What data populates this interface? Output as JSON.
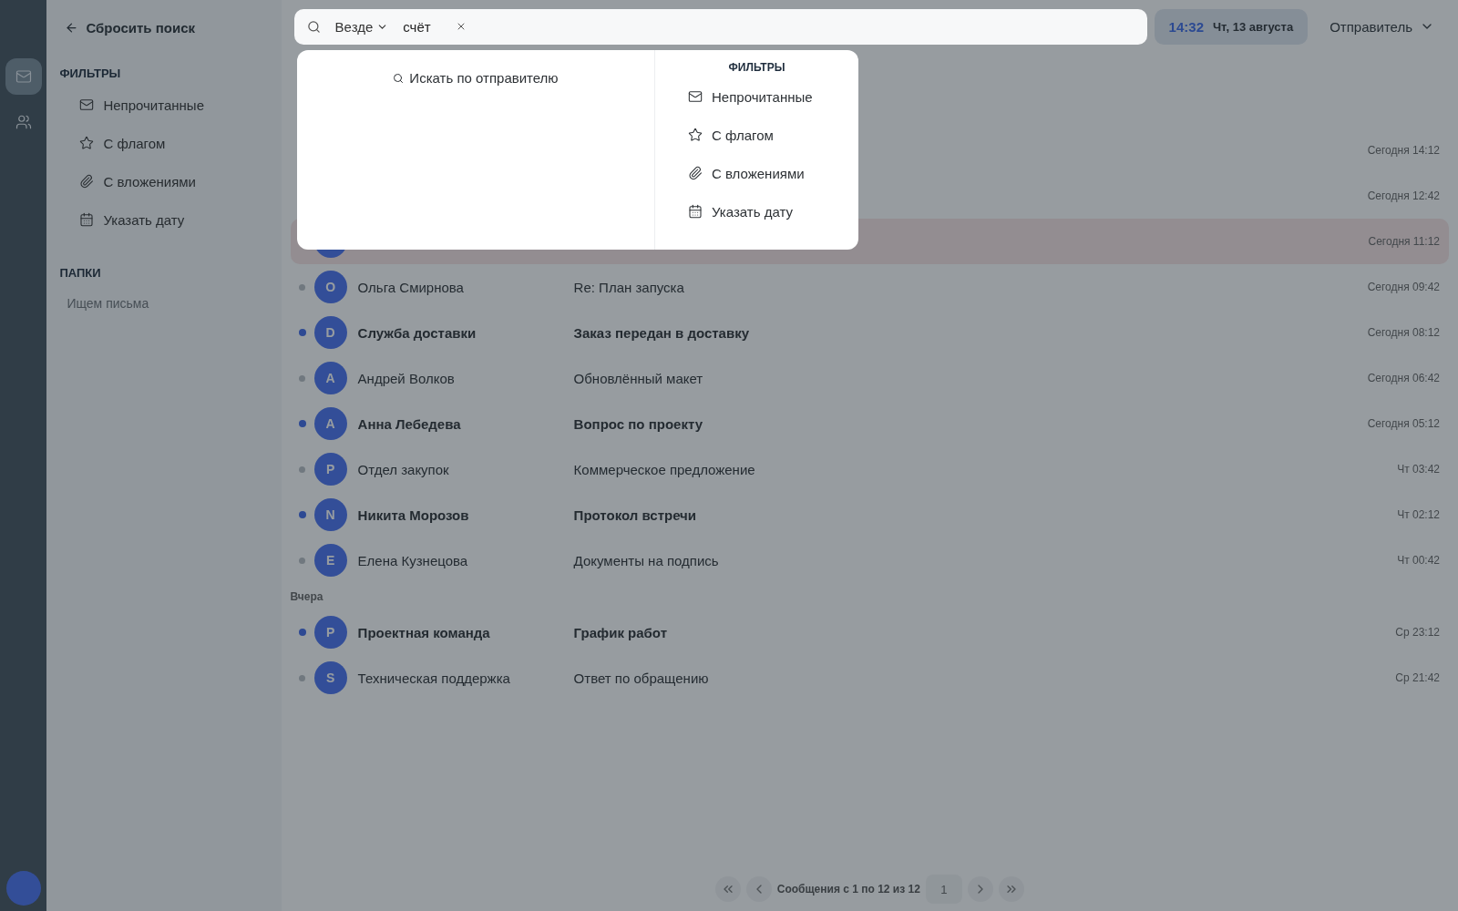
{
  "rail": {
    "items": [
      {
        "kind": "mail",
        "selected": true
      },
      {
        "kind": "users",
        "selected": false
      }
    ]
  },
  "sidebar": {
    "reset": "Сбросить поиск",
    "filters_title": "ФИЛЬТРЫ",
    "filters": [
      {
        "kind": "mail",
        "label": "Непрочитанные"
      },
      {
        "kind": "star",
        "label": "С флагом"
      },
      {
        "kind": "clip",
        "label": "С вложениями"
      },
      {
        "kind": "calendar",
        "label": "Указать дату"
      }
    ],
    "folders_title": "ПАПКИ",
    "folders_status": "Ищем письма"
  },
  "search": {
    "scope": "Везде",
    "query": "счёт"
  },
  "clock": {
    "time": "14:32",
    "date": "Чт, 13 августа"
  },
  "sender_filter": "Отправитель",
  "popup": {
    "search_by_sender": "Искать по отправителю",
    "filters_title": "ФИЛЬТРЫ",
    "filters": [
      {
        "kind": "mail",
        "label": "Непрочитанные"
      },
      {
        "kind": "star",
        "label": "С флагом"
      },
      {
        "kind": "clip",
        "label": "С вложениями"
      },
      {
        "kind": "calendar",
        "label": "Указать дату"
      }
    ]
  },
  "list": {
    "groups": [
      {
        "rows": [
          {
            "date": "Сегодня 14:12",
            "selected": false
          },
          {
            "date": "Сегодня 12:42",
            "selected": false
          },
          {
            "avatar": true,
            "date": "Сегодня 11:12",
            "selected": true
          },
          {
            "unread": false,
            "avatar": "O",
            "sender": "Ольга Смирнова",
            "subject": "Re: План запуска",
            "date": "Сегодня 09:42",
            "selected": false
          },
          {
            "unread": true,
            "avatar": "D",
            "sender": "Служба доставки",
            "subject": "Заказ передан в доставку",
            "date": "Сегодня 08:12",
            "selected": false
          },
          {
            "unread": false,
            "avatar": "A",
            "sender": "Андрей Волков",
            "subject": "Обновлённый макет",
            "date": "Сегодня 06:42",
            "selected": false
          },
          {
            "unread": true,
            "avatar": "A",
            "sender": "Анна Лебедева",
            "subject": "Вопрос по проекту",
            "date": "Сегодня 05:12",
            "selected": false
          },
          {
            "unread": false,
            "avatar": "P",
            "sender": "Отдел закупок",
            "subject": "Коммерческое предложение",
            "date": "Чт 03:42",
            "selected": false
          },
          {
            "unread": true,
            "avatar": "N",
            "sender": "Никита Морозов",
            "subject": "Протокол встречи",
            "date": "Чт 02:12",
            "selected": false
          },
          {
            "unread": false,
            "avatar": "E",
            "sender": "Елена Кузнецова",
            "subject": "Документы на подпись",
            "date": "Чт 00:42",
            "selected": false
          }
        ]
      },
      {
        "label": "Вчера",
        "rows": [
          {
            "unread": true,
            "avatar": "P",
            "sender": "Проектная команда",
            "subject": "График работ",
            "date": "Ср 23:12",
            "selected": false
          },
          {
            "unread": false,
            "avatar": "S",
            "sender": "Техническая поддержка",
            "subject": "Ответ по обращению",
            "date": "Ср 21:42",
            "selected": false
          }
        ]
      }
    ]
  },
  "pagination": {
    "summary": "Сообщения с 1 по 12 из 12",
    "page": "1"
  }
}
